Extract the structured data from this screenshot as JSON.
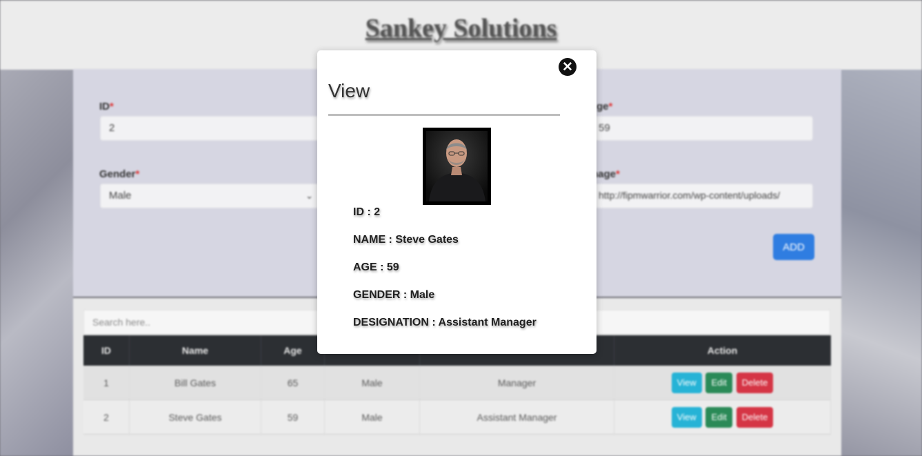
{
  "header": {
    "brand": "Sankey Solutions"
  },
  "form": {
    "id_label": "ID",
    "id_value": "2",
    "age_label": "ge",
    "age_value": "59",
    "gender_label": "Gender",
    "gender_value": "Male",
    "image_label": "nage",
    "image_value": "http://fipmwarrior.com/wp-content/uploads/",
    "required_mark": "*",
    "add_button": "ADD"
  },
  "search": {
    "placeholder": "Search here.."
  },
  "table": {
    "columns": [
      "ID",
      "Name",
      "Age",
      "",
      "",
      "Action"
    ],
    "rows": [
      {
        "id": "1",
        "name": "Bill Gates",
        "age": "65",
        "gender": "Male",
        "designation": "Manager"
      },
      {
        "id": "2",
        "name": "Steve Gates",
        "age": "59",
        "gender": "Male",
        "designation": "Assistant Manager"
      }
    ],
    "actions": {
      "view": "View",
      "edit": "Edit",
      "delete": "Delete"
    }
  },
  "modal": {
    "title": "View",
    "close_icon": "close-icon",
    "lines": [
      "ID : 2",
      "NAME : Steve Gates",
      "AGE : 59",
      "GENDER : Male",
      "DESIGNATION : Assistant Manager"
    ]
  },
  "colors": {
    "add_button": "#2f7de1",
    "view_button": "#26b3d6",
    "edit_button": "#2a8a57",
    "delete_button": "#d53545",
    "table_header": "#2c2f33",
    "required": "#d33333"
  }
}
